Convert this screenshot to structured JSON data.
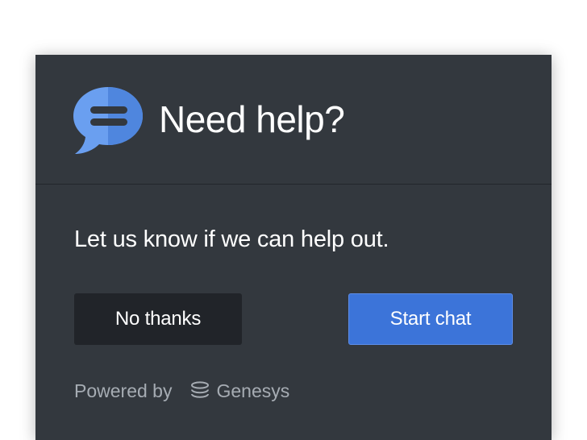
{
  "dialog": {
    "title": "Need help?",
    "message": "Let us know if we can help out.",
    "buttons": {
      "decline_label": "No thanks",
      "accept_label": "Start chat"
    },
    "footer": {
      "powered_by": "Powered by",
      "brand": "Genesys"
    }
  },
  "colors": {
    "dialog_background": "#33383e",
    "primary_button": "#3c74d9",
    "secondary_button": "#212429",
    "chat_icon_blue": "#6a9ff0"
  },
  "icons": {
    "header": "chat-bubble-icon",
    "brand": "genesys-logo-icon"
  }
}
